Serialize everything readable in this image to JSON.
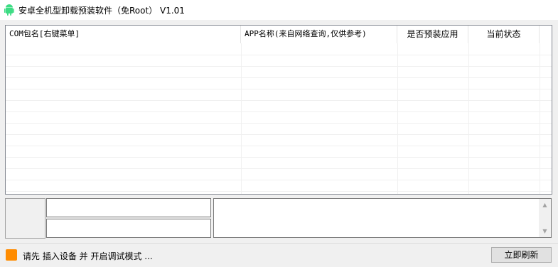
{
  "window": {
    "title": "安卓全机型卸载预装软件（免Root） V1.01",
    "icon": "android-icon"
  },
  "list": {
    "columns": [
      {
        "label": "COM包名[右键菜单]"
      },
      {
        "label": "APP名称(来自网络查询,仅供参考)"
      },
      {
        "label": "是否预装应用"
      },
      {
        "label": "当前状态"
      }
    ],
    "rows": []
  },
  "inputs": {
    "field_top": "",
    "field_bottom": "",
    "log_text": ""
  },
  "status": {
    "message": "请先 插入设备 并 开启调试模式 ...",
    "indicator_color": "#ff8c00",
    "refresh_label": "立即刷新"
  },
  "colors": {
    "android_green": "#3ddc84",
    "window_bg": "#f0f0f0"
  }
}
